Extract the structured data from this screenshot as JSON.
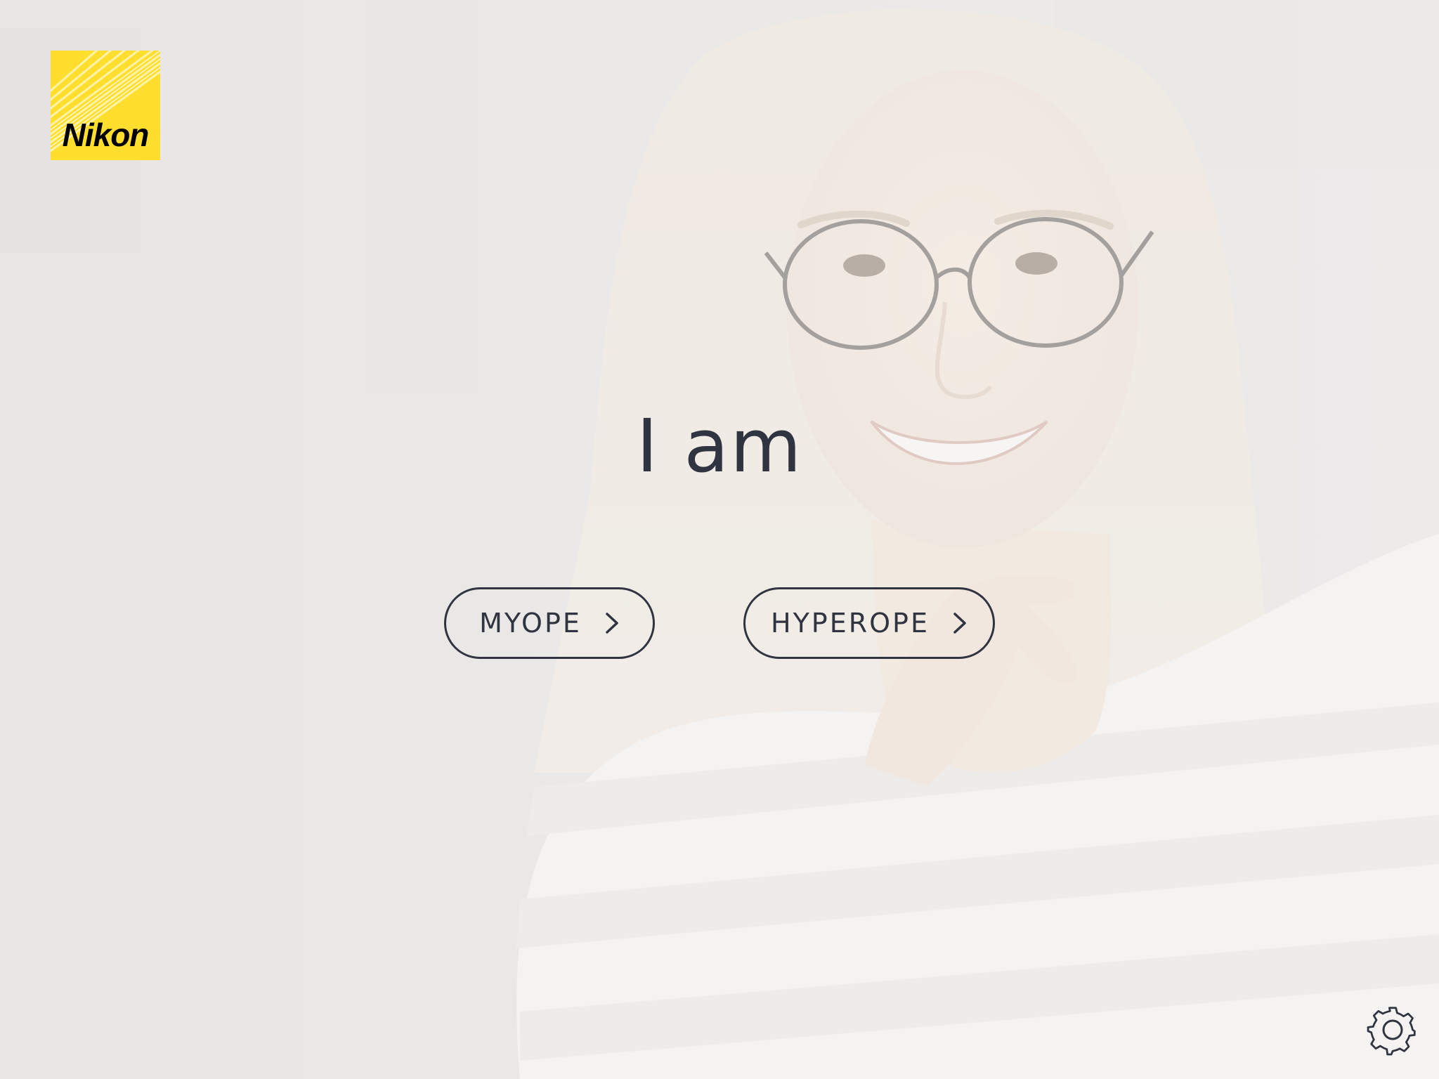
{
  "app": {
    "brand": "Nikon"
  },
  "hero": {
    "heading": "I am"
  },
  "choices": [
    {
      "label": "MYOPE",
      "icon": "chevron-right-icon"
    },
    {
      "label": "HYPEROPE",
      "icon": "chevron-right-icon"
    }
  ],
  "footer": {
    "settings_icon": "gear-icon"
  },
  "colors": {
    "text": "#2f3440",
    "brand_yellow": "#ffde2e",
    "background": "#e9e8e7"
  }
}
